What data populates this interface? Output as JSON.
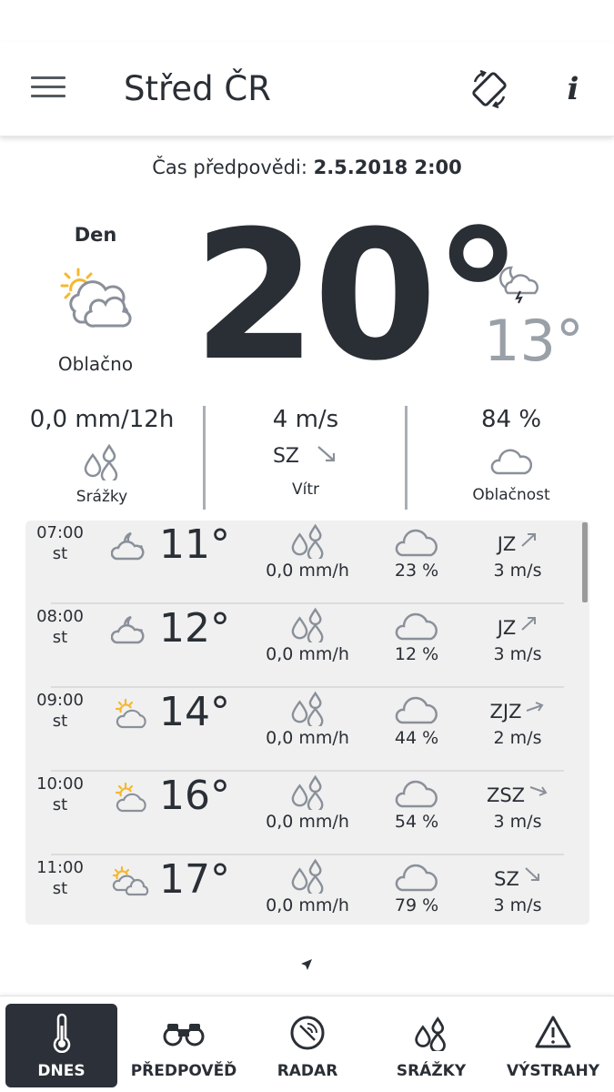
{
  "header": {
    "title": "Střed ČR"
  },
  "forecast_time": {
    "label": "Čas předpovědi:",
    "value": "2.5.2018 2:00"
  },
  "current": {
    "day_label": "Den",
    "day_condition": "Oblačno",
    "temperature": "20°",
    "night_temperature": "13°"
  },
  "stats": {
    "precipitation": {
      "value": "0,0 mm/12h",
      "label": "Srážky"
    },
    "wind": {
      "value": "4 m/s",
      "direction": "SZ",
      "label": "Vítr"
    },
    "cloudiness": {
      "value": "84 %",
      "label": "Oblačnost"
    }
  },
  "hourly": [
    {
      "time": "07:00",
      "day": "st",
      "icon": "moon-cloud-icon",
      "temp": "11°",
      "precip": "0,0 mm/h",
      "cloud": "23 %",
      "wind_dir": "JZ",
      "wind_speed": "3 m/s"
    },
    {
      "time": "08:00",
      "day": "st",
      "icon": "moon-cloud-icon",
      "temp": "12°",
      "precip": "0,0 mm/h",
      "cloud": "12 %",
      "wind_dir": "JZ",
      "wind_speed": "3 m/s"
    },
    {
      "time": "09:00",
      "day": "st",
      "icon": "sun-cloud-icon",
      "temp": "14°",
      "precip": "0,0 mm/h",
      "cloud": "44 %",
      "wind_dir": "ZJZ",
      "wind_speed": "2 m/s"
    },
    {
      "time": "10:00",
      "day": "st",
      "icon": "sun-cloud-icon",
      "temp": "16°",
      "precip": "0,0 mm/h",
      "cloud": "54 %",
      "wind_dir": "ZSZ",
      "wind_speed": "3 m/s"
    },
    {
      "time": "11:00",
      "day": "st",
      "icon": "sun-clouds-icon",
      "temp": "17°",
      "precip": "0,0 mm/h",
      "cloud": "79 %",
      "wind_dir": "SZ",
      "wind_speed": "3 m/s"
    }
  ],
  "bottom_nav": [
    {
      "label": "DNES",
      "icon": "thermometer-icon",
      "active": true
    },
    {
      "label": "PŘEDPOVĚĎ",
      "icon": "binoculars-icon",
      "active": false
    },
    {
      "label": "RADAR",
      "icon": "radar-icon",
      "active": false
    },
    {
      "label": "SRÁŽKY",
      "icon": "raindrops-icon",
      "active": false
    },
    {
      "label": "VÝSTRAHY",
      "icon": "warning-icon",
      "active": false
    }
  ],
  "colors": {
    "text": "#2a2f36",
    "muted": "#9aa0a8",
    "sun": "#f5b82e",
    "active_nav": "#2c3038",
    "panel": "#f0f0f0"
  }
}
